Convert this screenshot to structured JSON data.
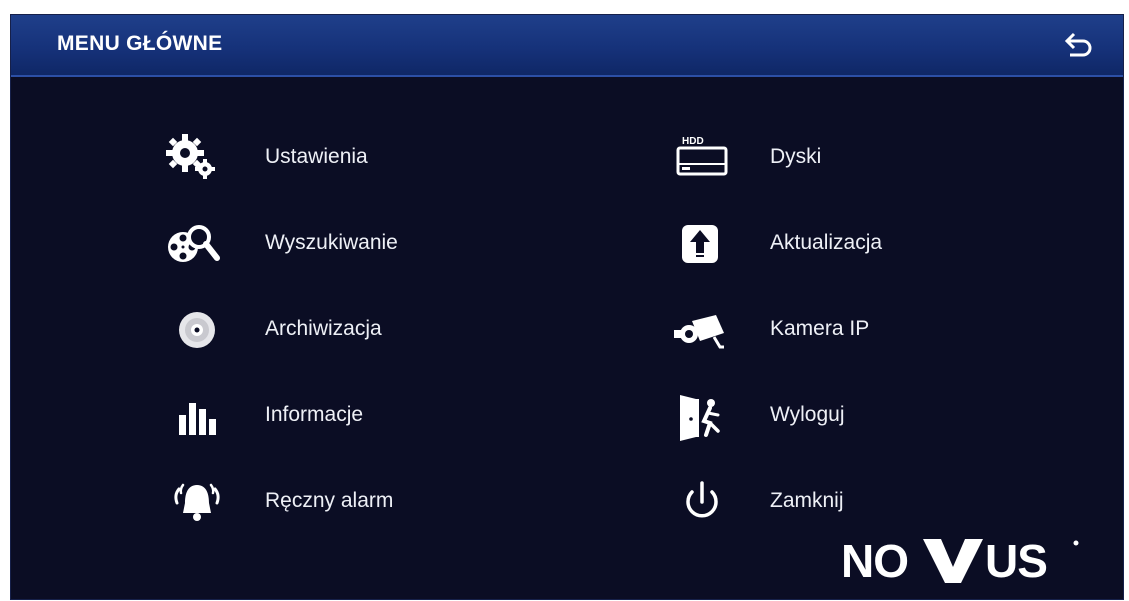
{
  "header": {
    "title": "MENU GŁÓWNE",
    "back_icon": "back-arrow-icon"
  },
  "menu": {
    "left": [
      {
        "label": "Ustawienia",
        "icon": "gears-icon"
      },
      {
        "label": "Wyszukiwanie",
        "icon": "film-search-icon"
      },
      {
        "label": "Archiwizacja",
        "icon": "disc-icon"
      },
      {
        "label": "Informacje",
        "icon": "bar-chart-icon"
      },
      {
        "label": "Ręczny alarm",
        "icon": "alarm-bell-icon"
      }
    ],
    "right": [
      {
        "label": "Dyski",
        "icon": "hdd-icon"
      },
      {
        "label": "Aktualizacja",
        "icon": "upgrade-icon"
      },
      {
        "label": "Kamera IP",
        "icon": "ip-camera-icon"
      },
      {
        "label": "Wyloguj",
        "icon": "logout-icon"
      },
      {
        "label": "Zamknij",
        "icon": "power-icon"
      }
    ]
  },
  "brand": {
    "logo_text": "NOVUS"
  },
  "colors": {
    "background": "#0b0d24",
    "titlebar": "#16327a",
    "text": "#eef0f6"
  }
}
